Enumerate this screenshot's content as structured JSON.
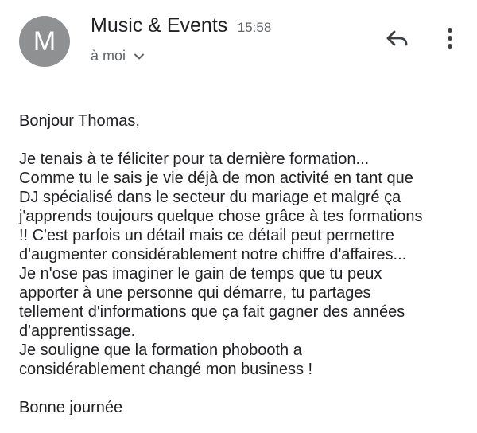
{
  "sender": {
    "avatar_letter": "M",
    "name": "Music & Events",
    "time": "15:58",
    "recipient": "à moi"
  },
  "icons": {
    "recipient_toggle": "chevron-down-icon",
    "reply": "reply-icon",
    "more": "more-vert-icon"
  },
  "colors": {
    "avatar_bg": "#8f9092",
    "text_primary": "#202124",
    "text_secondary": "#5f6368"
  },
  "message": {
    "greeting": "Bonjour Thomas,",
    "lines": [
      "Je tenais à te féliciter pour ta dernière formation...",
      "Comme tu le sais je vie déjà de mon activité en tant que",
      "DJ spécialisé dans le secteur du mariage et malgré ça",
      "j'apprends toujours quelque chose grâce à tes formations",
      "!! C'est parfois un détail mais ce détail peut permettre",
      "d'augmenter considérablement notre chiffre d'affaires...",
      "Je n'ose pas imaginer le gain de temps que tu peux",
      "apporter à une personne qui démarre, tu partages",
      "tellement d'informations que ça fait gagner des années",
      "d'apprentissage.",
      "Je souligne que la formation phobooth a",
      "considérablement changé mon business !"
    ],
    "closing": "Bonne journée"
  }
}
